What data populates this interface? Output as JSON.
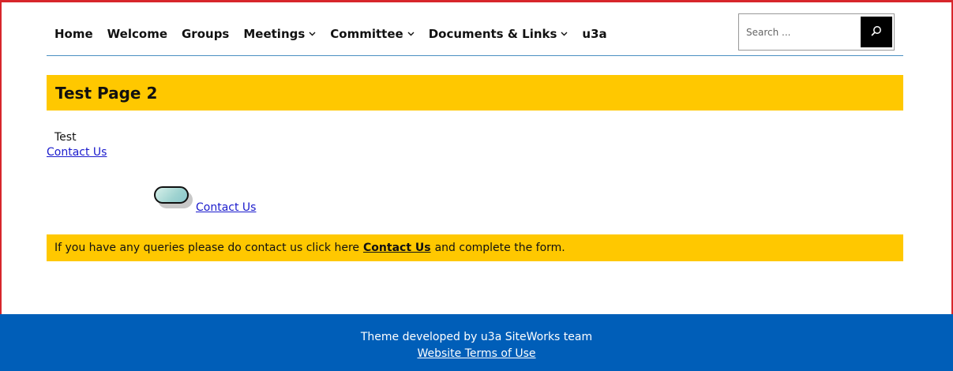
{
  "nav": {
    "items": [
      {
        "label": "Home",
        "has_dropdown": false
      },
      {
        "label": "Welcome",
        "has_dropdown": false
      },
      {
        "label": "Groups",
        "has_dropdown": false
      },
      {
        "label": "Meetings",
        "has_dropdown": true
      },
      {
        "label": "Committee",
        "has_dropdown": true
      },
      {
        "label": "Documents & Links",
        "has_dropdown": true
      },
      {
        "label": "u3a",
        "has_dropdown": false
      }
    ],
    "dropdown_icon": "chevron-down-icon"
  },
  "search": {
    "placeholder": "Search ...",
    "button_icon": "search-icon"
  },
  "page": {
    "title": "Test Page 2",
    "body_text": "Test",
    "contact_link_1": "Contact Us",
    "contact_link_2": "Contact Us",
    "info_prefix": "If you have any queries please do contact us click here",
    "info_link": "Contact Us",
    "info_suffix": "and complete the form."
  },
  "footer": {
    "credit": "Theme developed by u3a SiteWorks team",
    "terms_link": "Website Terms of Use"
  },
  "colors": {
    "accent_yellow": "#ffc800",
    "footer_blue": "#005eb8",
    "frame_red": "#d7262b",
    "link_blue": "#1a1acc"
  }
}
